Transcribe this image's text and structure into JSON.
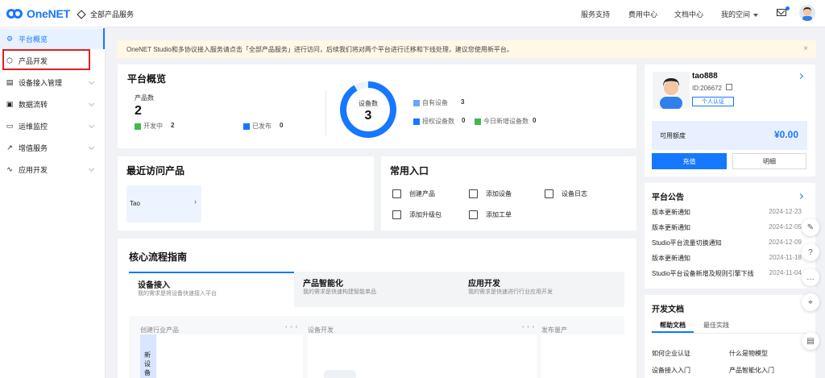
{
  "topbar": {
    "logo_text": "OneNET",
    "all_products": "全部产品服务",
    "nav": [
      "服务支持",
      "费用中心",
      "文档中心",
      "我的空间"
    ]
  },
  "sidebar": {
    "items": [
      {
        "label": "平台概览",
        "icon": "home-icon"
      },
      {
        "label": "产品开发",
        "icon": "cube-icon"
      },
      {
        "label": "设备接入管理",
        "icon": "device-icon"
      },
      {
        "label": "数据流转",
        "icon": "data-flow-icon"
      },
      {
        "label": "运维监控",
        "icon": "monitor-icon"
      },
      {
        "label": "增值服务",
        "icon": "trend-icon"
      },
      {
        "label": "应用开发",
        "icon": "app-icon"
      }
    ]
  },
  "notice": {
    "text": "OneNET Studio和多协议接入服务请点击「全部产品服务」进行访问，后续我们将对两个平台进行迁移和下线处理，建议您使用新平台。",
    "close": "×"
  },
  "overview": {
    "title": "平台概览",
    "product_count_label": "产品数",
    "product_count": "2",
    "dev_label": "开发中",
    "dev_count": "2",
    "published_label": "已发布",
    "published_count": "0",
    "device_count_label": "设备数",
    "device_count": "3",
    "own_devices_label": "自有设备",
    "own_devices": "3",
    "authorized_label": "授权设备数",
    "authorized": "0",
    "today_new_label": "今日新增设备数",
    "today_new": "0"
  },
  "recent": {
    "title": "最近访问产品",
    "items": [
      "Tao"
    ]
  },
  "entries": {
    "title": "常用入口",
    "items": [
      "创建产品",
      "添加设备",
      "设备日志",
      "添加升级包",
      "添加工单"
    ]
  },
  "flow": {
    "title": "核心流程指南",
    "tabs": [
      {
        "title": "设备接入",
        "sub": "我的需求是将设备快速接入平台"
      },
      {
        "title": "产品智能化",
        "sub": "我的需求是快速构建智能单品"
      },
      {
        "title": "应用开发",
        "sub": "我的需求是快速进行行业应用开发"
      }
    ],
    "columns": [
      "创建行业产品",
      "设备开发",
      "发布量产"
    ],
    "vertical_text": "新设备"
  },
  "profile": {
    "username": "tao888",
    "id": "ID:206672",
    "verify": "个人认证",
    "quota_label": "可用额度",
    "quota_value": "¥0.00",
    "recharge": "充值",
    "detail": "明细"
  },
  "announcements": {
    "title": "平台公告",
    "items": [
      {
        "title": "版本更新通知",
        "date": "2024-12-23"
      },
      {
        "title": "版本更新通知",
        "date": "2024-12-05"
      },
      {
        "title": "Studio平台流量切换通知",
        "date": "2024-12-09"
      },
      {
        "title": "版本更新通知",
        "date": "2024-11-18"
      },
      {
        "title": "Studio平台设备新增及规则引擎下线",
        "date": "2024-11-04"
      }
    ]
  },
  "docs": {
    "title": "开发文档",
    "tabs": [
      "帮助文档",
      "最佳实践"
    ],
    "links": [
      "如何企业认证",
      "什么是物模型",
      "设备接入入门",
      "产品智能化入门"
    ]
  }
}
